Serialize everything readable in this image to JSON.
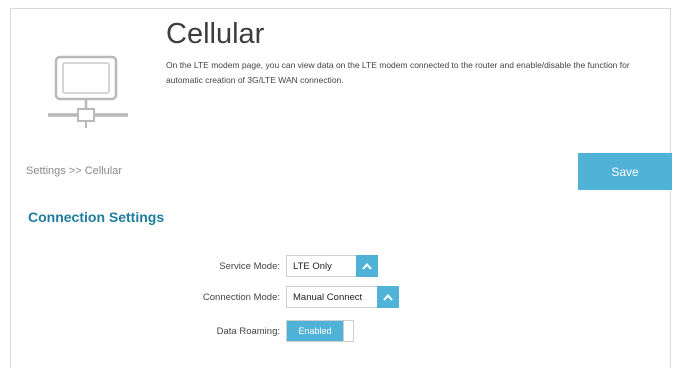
{
  "page": {
    "title": "Cellular",
    "description": "On the LTE modem page, you can view data on the LTE modem connected to the router and enable/disable the function for automatic creation of 3G/LTE WAN connection."
  },
  "breadcrumb": "Settings >> Cellular",
  "toolbar": {
    "save_label": "Save"
  },
  "section": {
    "title": "Connection Settings"
  },
  "fields": {
    "service_mode": {
      "label": "Service Mode:",
      "value": "LTE Only"
    },
    "connection_mode": {
      "label": "Connection Mode:",
      "value": "Manual Connect"
    },
    "data_roaming": {
      "label": "Data Roaming:",
      "value": "Enabled"
    }
  },
  "colors": {
    "accent": "#4fb2d6",
    "section_title": "#1e7c9e"
  },
  "icons": {
    "router": "router-icon",
    "select_arrow": "chevron-up-icon"
  }
}
